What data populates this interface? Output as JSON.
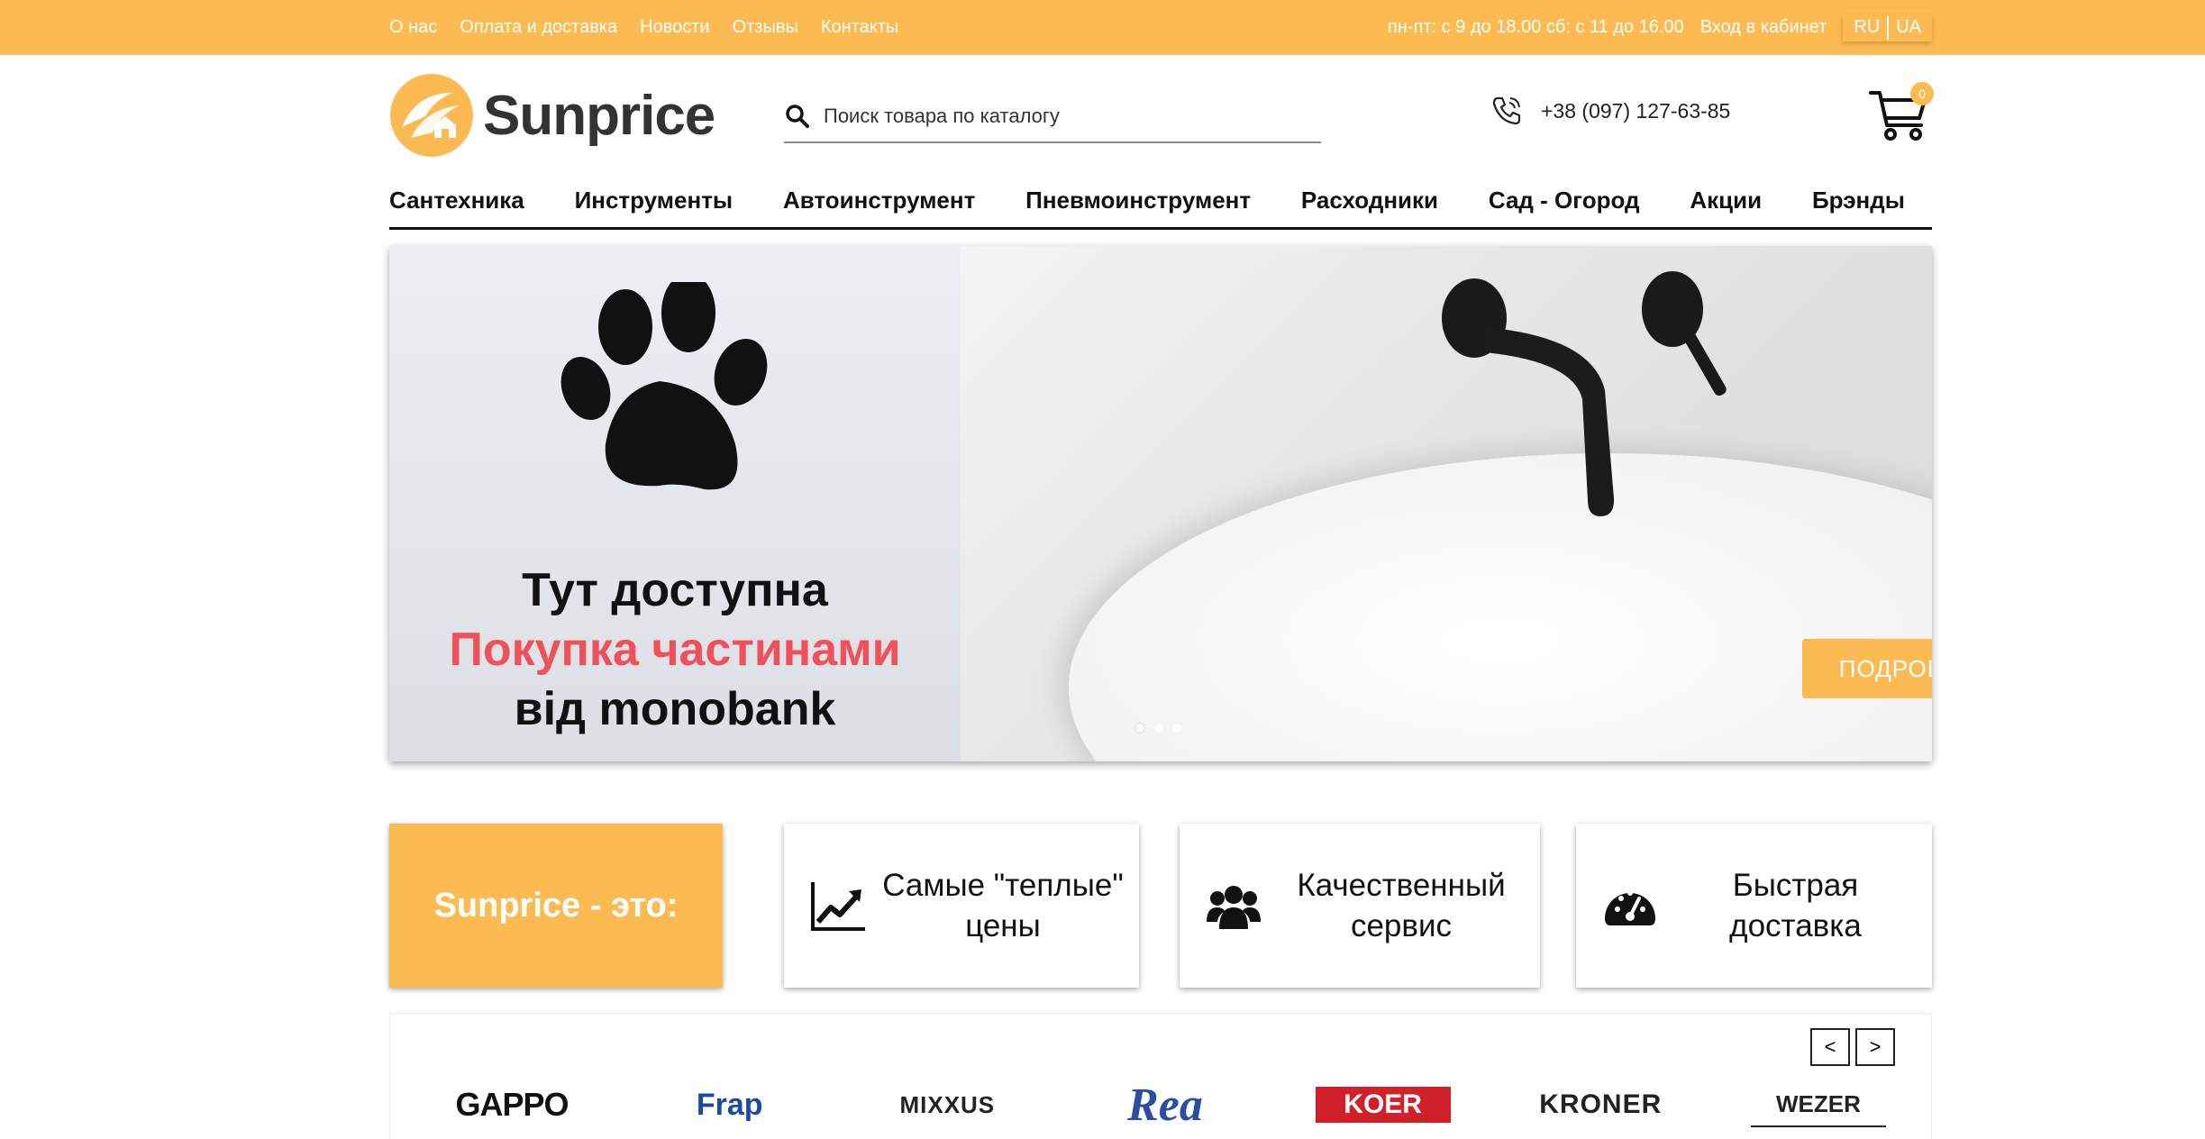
{
  "topbar": {
    "links": [
      "О нас",
      "Оплата и доставка",
      "Новости",
      "Отзывы",
      "Контакты"
    ],
    "schedule": "пн-пт: с 9 до 18.00 сб: с 11 до 16.00",
    "login": "Вход в кабинет",
    "lang_ru": "RU",
    "lang_ua": "UA"
  },
  "header": {
    "logo_text": "Sunprice",
    "search_placeholder": "Поиск товара по каталогу",
    "phone": "+38 (097) 127-63-85",
    "cart_count": "0"
  },
  "nav": [
    "Сантехника",
    "Инструменты",
    "Автоинструмент",
    "Пневмоинструмент",
    "Расходники",
    "Сад - Огород",
    "Акции",
    "Брэнды"
  ],
  "hero": {
    "promo_line1": "Тут доступна",
    "promo_line2": "Покупка частинами",
    "promo_line3": "від monobank",
    "button": "ПОДРОБНЕЕ",
    "slides": 3,
    "active_slide": 1
  },
  "features": {
    "title": "Sunprice - это:",
    "items": [
      {
        "text": "Самые \"теплые\" цены",
        "icon": "chart-line-icon"
      },
      {
        "text": "Качественный сервис",
        "icon": "users-icon"
      },
      {
        "text": "Быстрая доставка",
        "icon": "speedometer-icon"
      }
    ]
  },
  "brands": {
    "prev": "<",
    "next": ">",
    "items": [
      "GAPPO",
      "Frap",
      "MIXXUS",
      "Rea",
      "KOER",
      "KRONER",
      "WEZER"
    ]
  },
  "colors": {
    "accent": "#fcbb52",
    "promo_red": "#f0505a"
  }
}
